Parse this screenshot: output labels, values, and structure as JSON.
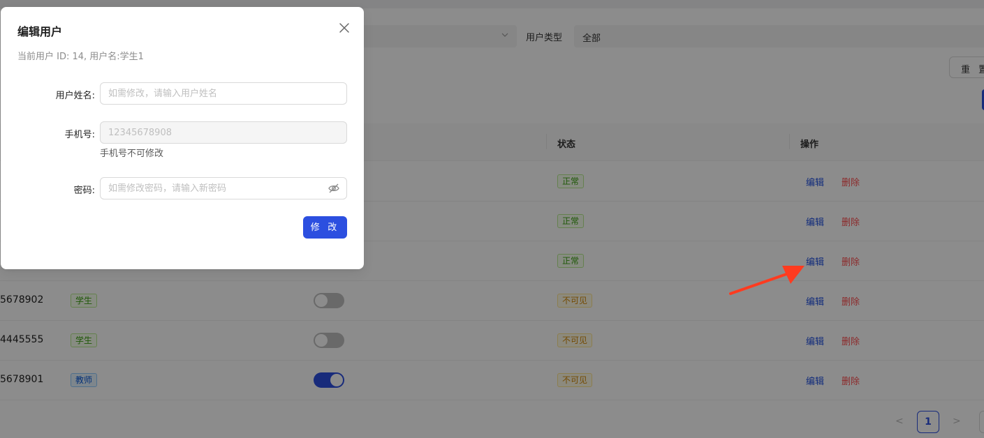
{
  "filters": {
    "user_type_label": "用户类型",
    "user_type_value": "全部",
    "reset_label": "重 置"
  },
  "table": {
    "headers": {
      "status": "状态",
      "actions": "操作"
    },
    "rows": [
      {
        "phone": "",
        "tag": "",
        "tag_kind": "",
        "switch": "",
        "status": "正常",
        "status_kind": "ok",
        "edit": "编辑",
        "delete": "删除"
      },
      {
        "phone": "",
        "tag": "",
        "tag_kind": "",
        "switch": "",
        "status": "正常",
        "status_kind": "ok",
        "edit": "编辑",
        "delete": "删除"
      },
      {
        "phone": "",
        "tag": "",
        "tag_kind": "",
        "switch": "",
        "status": "正常",
        "status_kind": "ok",
        "edit": "编辑",
        "delete": "删除"
      },
      {
        "phone": "5678902",
        "tag": "学生",
        "tag_kind": "student",
        "switch": "off",
        "status": "不可见",
        "status_kind": "hidden",
        "edit": "编辑",
        "delete": "删除"
      },
      {
        "phone": "4445555",
        "tag": "学生",
        "tag_kind": "student",
        "switch": "off",
        "status": "不可见",
        "status_kind": "hidden",
        "edit": "编辑",
        "delete": "删除"
      },
      {
        "phone": "5678901",
        "tag": "教师",
        "tag_kind": "teacher",
        "switch": "on",
        "status": "不可见",
        "status_kind": "hidden",
        "edit": "编辑",
        "delete": "删除"
      }
    ]
  },
  "pagination": {
    "prev": "<",
    "current": "1",
    "next": ">"
  },
  "modal": {
    "title": "编辑用户",
    "subtitle": "当前用户 ID: 14, 用户名:学生1",
    "fields": {
      "name_label": "用户姓名:",
      "name_placeholder": "如需修改，请输入用户姓名",
      "phone_label": "手机号:",
      "phone_value": "12345678908",
      "phone_help": "手机号不可修改",
      "password_label": "密码:",
      "password_placeholder": "如需修改密码，请输入新密码"
    },
    "submit_label": "修 改"
  },
  "colors": {
    "primary": "#2c4fe0",
    "danger": "#ff4d4f",
    "annotation_arrow": "#ff3b1f"
  },
  "icons": [
    "chevron-down-icon",
    "close-icon",
    "eye-off-icon",
    "annotation-arrow"
  ]
}
